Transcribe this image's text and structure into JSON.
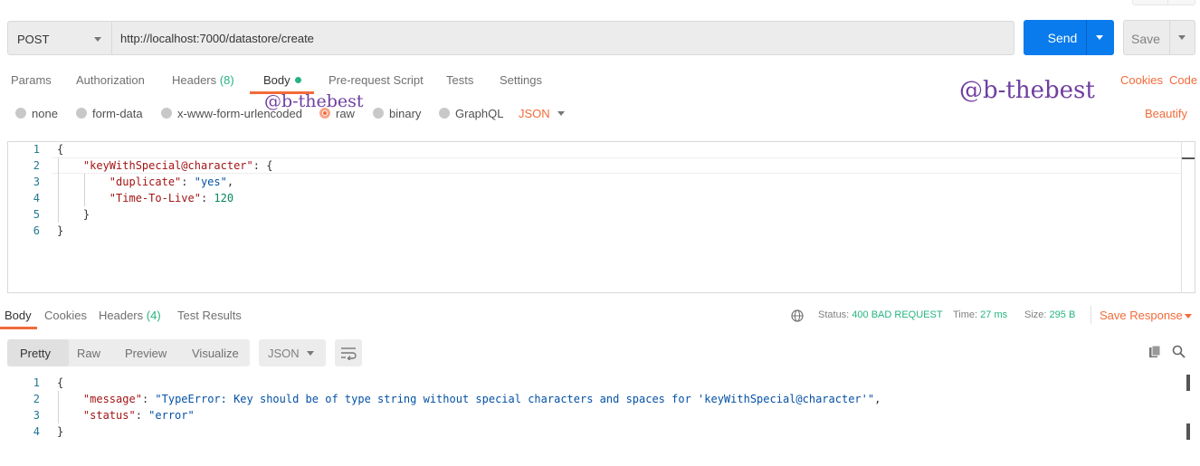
{
  "request": {
    "method": "POST",
    "url": "http://localhost:7000/datastore/create",
    "send_label": "Send",
    "save_label": "Save"
  },
  "request_tabs": {
    "params": "Params",
    "authorization": "Authorization",
    "headers": "Headers",
    "headers_count": "(8)",
    "body": "Body",
    "prerequest": "Pre-request Script",
    "tests": "Tests",
    "settings": "Settings",
    "cookies": "Cookies",
    "code": "Code"
  },
  "watermarks": [
    "@b-thebest",
    "@b-thebest"
  ],
  "body_types": {
    "none": "none",
    "form_data": "form-data",
    "urlencoded": "x-www-form-urlencoded",
    "raw": "raw",
    "binary": "binary",
    "graphql": "GraphQL",
    "format": "JSON",
    "beautify": "Beautify",
    "selected": "raw"
  },
  "request_body": {
    "line_numbers": [
      "1",
      "2",
      "3",
      "4",
      "5",
      "6"
    ],
    "open_brace": "{",
    "key_outer": "\"keyWithSpecial@character\"",
    "colon_brace": ": {",
    "key_dup": "\"duplicate\"",
    "val_dup": "\"yes\"",
    "key_ttl": "\"Time-To-Live\"",
    "val_ttl": "120",
    "close_inner": "}",
    "close_outer": "}"
  },
  "response_tabs": {
    "body": "Body",
    "cookies": "Cookies",
    "headers": "Headers",
    "headers_count": "(4)",
    "test_results": "Test Results"
  },
  "response_status": {
    "status_label": "Status:",
    "status_value": "400 BAD REQUEST",
    "time_label": "Time:",
    "time_value": "27 ms",
    "size_label": "Size:",
    "size_value": "295 B",
    "save_response": "Save Response"
  },
  "response_view": {
    "pretty": "Pretty",
    "raw": "Raw",
    "preview": "Preview",
    "visualize": "Visualize",
    "format": "JSON"
  },
  "response_body": {
    "line_numbers": [
      "1",
      "2",
      "3",
      "4"
    ],
    "open_brace": "{",
    "key_message": "\"message\"",
    "val_message": "\"TypeError: Key should be of type string without special characters and spaces for 'keyWithSpecial@character'\"",
    "key_status": "\"status\"",
    "val_status": "\"error\"",
    "close_brace": "}"
  },
  "colors": {
    "accent": "#f26b3a",
    "send": "#097bed",
    "success": "#26b47f",
    "watermark": "#6f3fa1"
  }
}
